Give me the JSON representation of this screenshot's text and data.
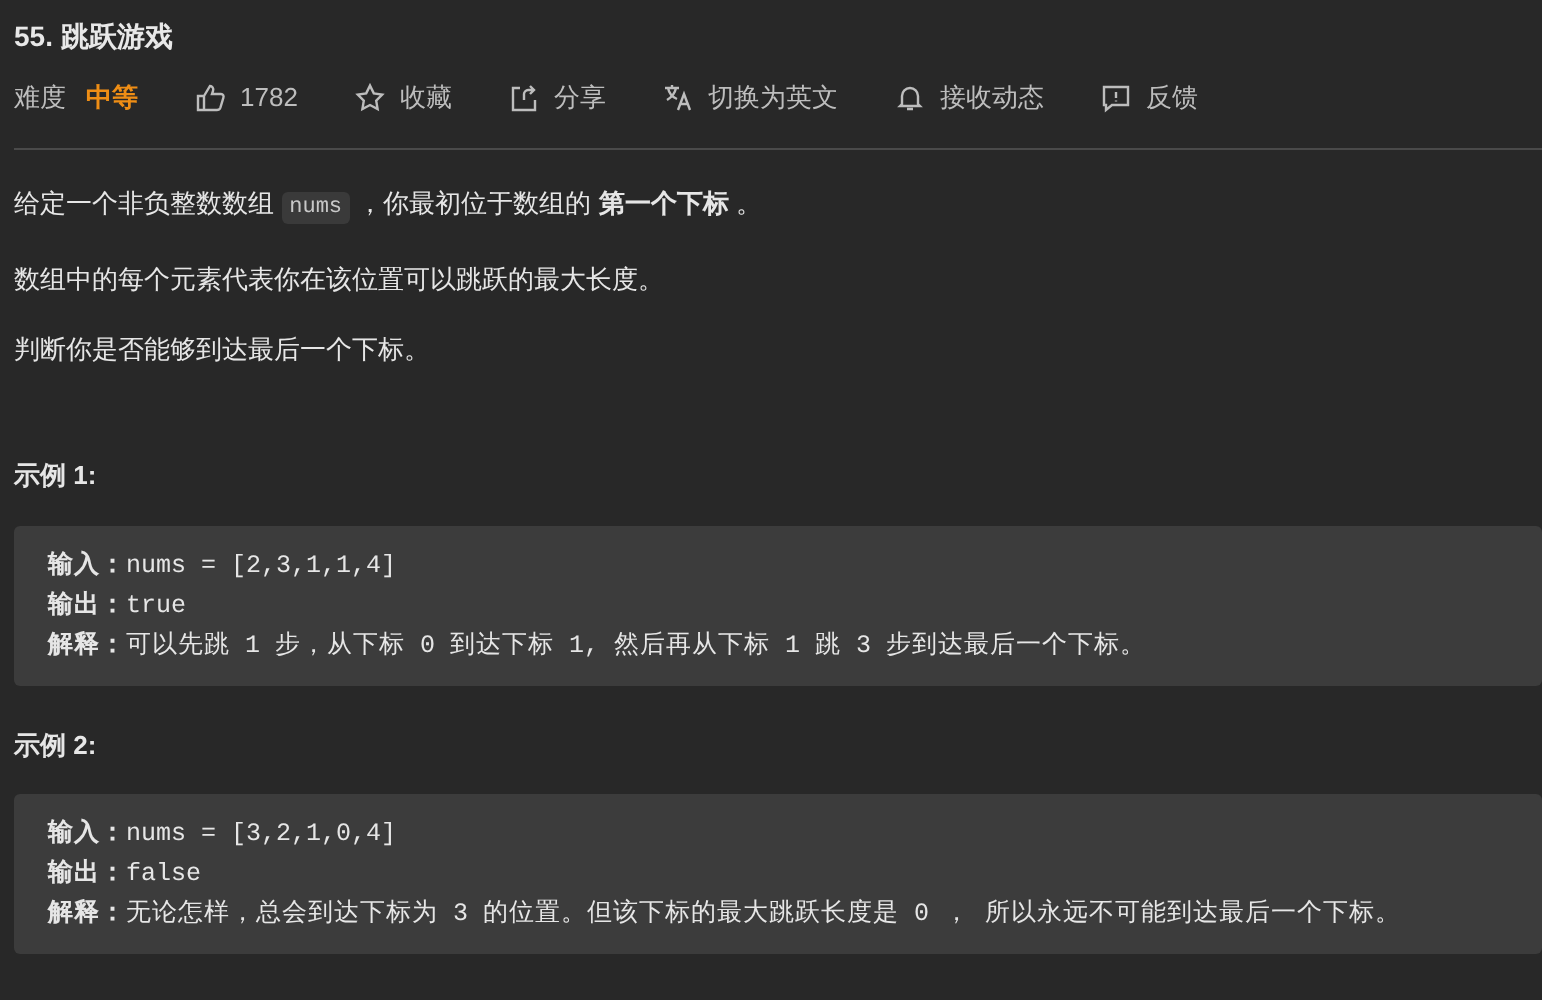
{
  "title": "55. 跳跃游戏",
  "toolbar": {
    "difficulty_label": "难度",
    "difficulty": {
      "label": "中等",
      "color": "#ef8e15"
    },
    "actions": [
      {
        "kind": "like",
        "label": "1782"
      },
      {
        "kind": "star",
        "label": "收藏"
      },
      {
        "kind": "share",
        "label": "分享"
      },
      {
        "kind": "translate",
        "label": "切换为英文"
      },
      {
        "kind": "bell",
        "label": "接收动态"
      },
      {
        "kind": "feedback",
        "label": "反馈"
      }
    ]
  },
  "description": [
    {
      "parts": [
        {
          "kind": "text",
          "text": "给定一个非负整数数组 "
        },
        {
          "kind": "code",
          "text": "nums"
        },
        {
          "kind": "text",
          "text": " ，你最初位于数组的 **第一个下标** 。"
        }
      ]
    },
    {
      "parts": [
        {
          "kind": "text",
          "text": "数组中的每个元素代表你在该位置可以跳跃的最大长度。"
        }
      ]
    },
    {
      "parts": [
        {
          "kind": "text",
          "text": "判断你是否能够到达最后一个下标。"
        }
      ]
    }
  ],
  "examples": [
    {
      "heading": "示例 1:",
      "lines": [
        "**输入：**nums = [2,3,1,1,4]",
        "**输出：**true",
        "**解释：**可以先跳 1 步，从下标 0 到达下标 1, 然后再从下标 1 跳 3 步到达最后一个下标。"
      ]
    },
    {
      "heading": "示例 2:",
      "lines": [
        "**输入：**nums = [3,2,1,0,4]",
        "**输出：**false",
        "**解释：**无论怎样，总会到达下标为 3 的位置。但该下标的最大跳跃长度是 0 ， 所以永远不可能到达最后一个下标。"
      ]
    }
  ]
}
